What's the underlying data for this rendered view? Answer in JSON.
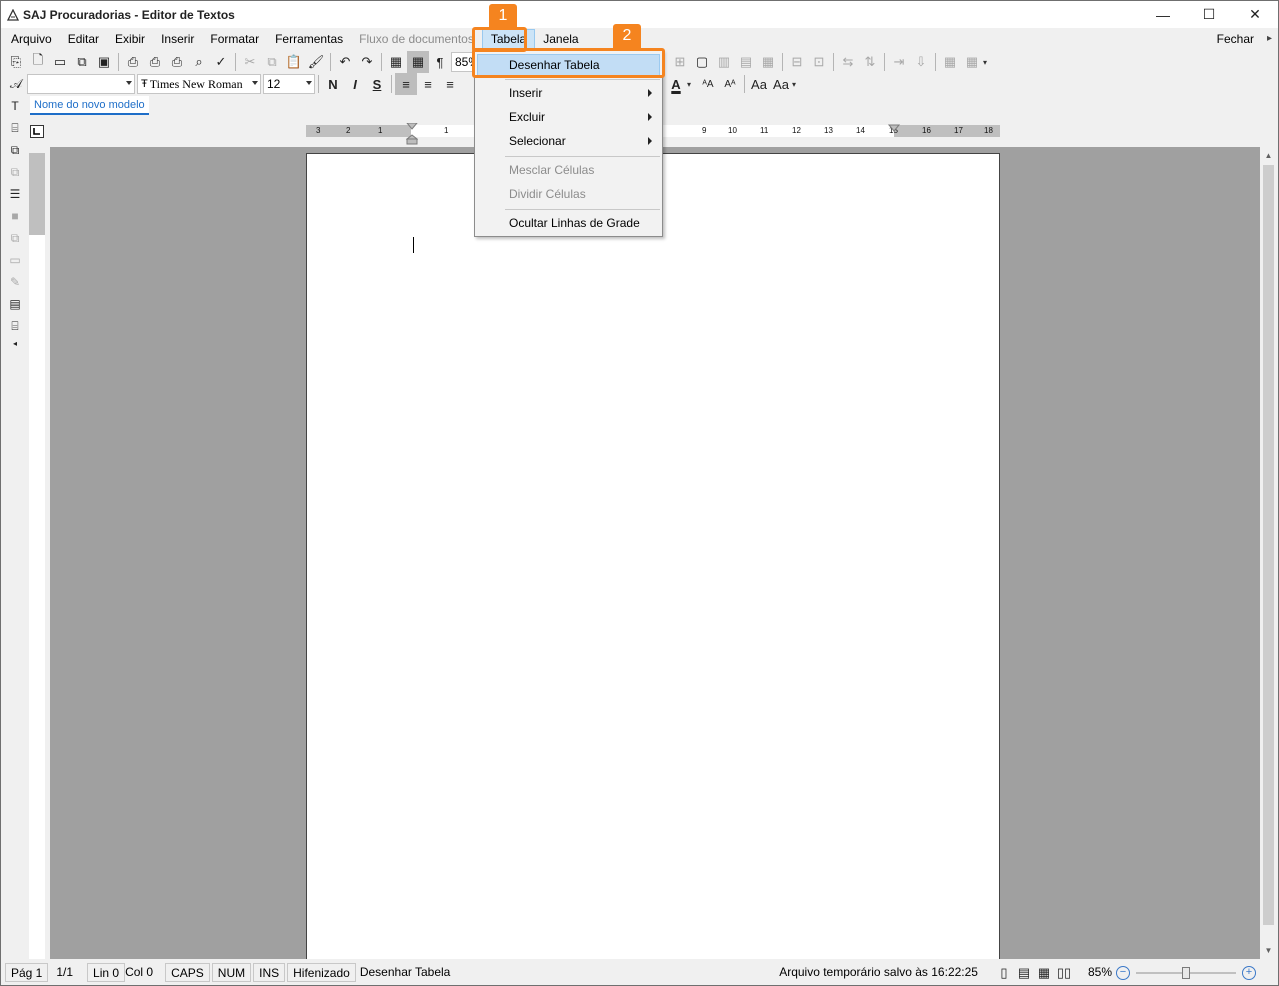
{
  "window": {
    "title": "SAJ Procuradorias - Editor de Textos",
    "controls": {
      "minimize": "—",
      "maximize": "☐",
      "close": "✕"
    }
  },
  "menubar": {
    "items": [
      "Arquivo",
      "Editar",
      "Exibir",
      "Inserir",
      "Formatar",
      "Ferramentas",
      "Fluxo de documentos",
      "Tabela",
      "Janela"
    ],
    "close_label": "Fechar"
  },
  "toolbar": {
    "zoom_value": "85%",
    "style_value": "",
    "font_value": "Times New Roman",
    "font_size_value": "12",
    "bold_label": "N",
    "italic_label": "I",
    "underline_label": "S"
  },
  "model_tab": {
    "label": "Nome do novo modelo"
  },
  "ruler": {
    "h_labels": [
      "3",
      "2",
      "1",
      "1",
      "9",
      "10",
      "11",
      "12",
      "13",
      "14",
      "15",
      "16",
      "17",
      "18"
    ]
  },
  "dropdown": {
    "items": [
      {
        "label": "Desenhar Tabela",
        "state": "highlighted",
        "submenu": false
      },
      {
        "label": "Inserir",
        "state": "enabled",
        "submenu": true
      },
      {
        "label": "Excluir",
        "state": "enabled",
        "submenu": true
      },
      {
        "label": "Selecionar",
        "state": "enabled",
        "submenu": true
      },
      {
        "label": "Mesclar Células",
        "state": "disabled",
        "submenu": false
      },
      {
        "label": "Dividir Células",
        "state": "disabled",
        "submenu": false
      },
      {
        "label": "Ocultar Linhas de Grade",
        "state": "enabled",
        "submenu": false
      }
    ]
  },
  "callouts": [
    {
      "number": "1",
      "target": "Tabela menu"
    },
    {
      "number": "2",
      "target": "Desenhar Tabela"
    }
  ],
  "statusbar": {
    "page": "Pág 1",
    "page_count": "1/1",
    "line": "Lin 0",
    "col": "Col 0",
    "caps": "CAPS",
    "num": "NUM",
    "ins": "INS",
    "hyphen": "Hifenizado",
    "action": "Desenhar Tabela",
    "saved_msg": "Arquivo temporário salvo às 16:22:25",
    "zoom": "85%",
    "zoom_level": 0.5
  },
  "colors": {
    "accent_orange": "#f5841f",
    "highlight_blue": "#c2ddf5",
    "workspace_gray": "#a0a0a0"
  }
}
